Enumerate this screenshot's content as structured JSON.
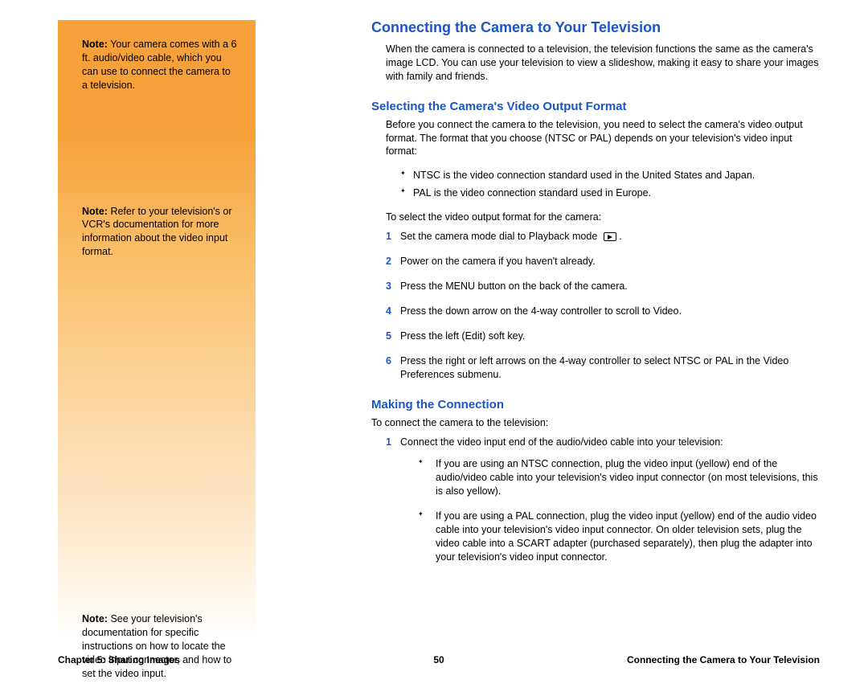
{
  "sidebar": {
    "notes": [
      {
        "label": "Note:",
        "text": "Your camera comes with a 6 ft. audio/video cable, which you can use to connect the camera to a television."
      },
      {
        "label": "Note:",
        "text": "Refer to your television's or VCR's documentation for more information about the video input format."
      },
      {
        "label": "Note:",
        "text": "See your television's documentation for specific instructions on how to locate the video input connector, and how to set the video input."
      }
    ]
  },
  "main": {
    "title": "Connecting the Camera to Your Television",
    "intro": "When the camera is connected to a television, the television functions the same as the camera's image LCD. You can use your television to view a slideshow, making it easy to share your images with family and friends.",
    "section1": {
      "heading": "Selecting the Camera's Video Output Format",
      "para": "Before you connect the camera to the television, you need to select the camera's video output format. The format that you choose (NTSC or PAL) depends on your television's video input format:",
      "bullets": [
        "NTSC is the video connection standard used in the United States and Japan.",
        "PAL is the video connection standard used in Europe."
      ],
      "lead": "To select the video output format for the camera:",
      "steps": [
        "Set the camera mode dial to Playback mode",
        "Power on the camera if you haven't already.",
        "Press the MENU button on the back of the camera.",
        "Press the down arrow on the 4-way controller to scroll to Video.",
        "Press the left (Edit) soft key.",
        "Press the right or left arrows on the 4-way controller to select NTSC or PAL in the Video Preferences submenu."
      ]
    },
    "section2": {
      "heading": "Making the Connection",
      "lead": "To connect the camera to the television:",
      "step1": "Connect the video input end of the audio/video cable into your television:",
      "sub_bullets": [
        "If you are using an NTSC connection, plug the video input (yellow) end of the audio/video cable into your television's video input connector (on most televisions, this is also yellow).",
        "If you are using a PAL connection, plug the video input (yellow) end of the audio video cable into your television's video input connector. On older television sets, plug the video cable into a SCART adapter (purchased separately), then plug the adapter into your television's video input connector."
      ]
    }
  },
  "footer": {
    "left": "Chapter 5: Sharing Images",
    "center": "50",
    "right": "Connecting the Camera to Your Television"
  }
}
